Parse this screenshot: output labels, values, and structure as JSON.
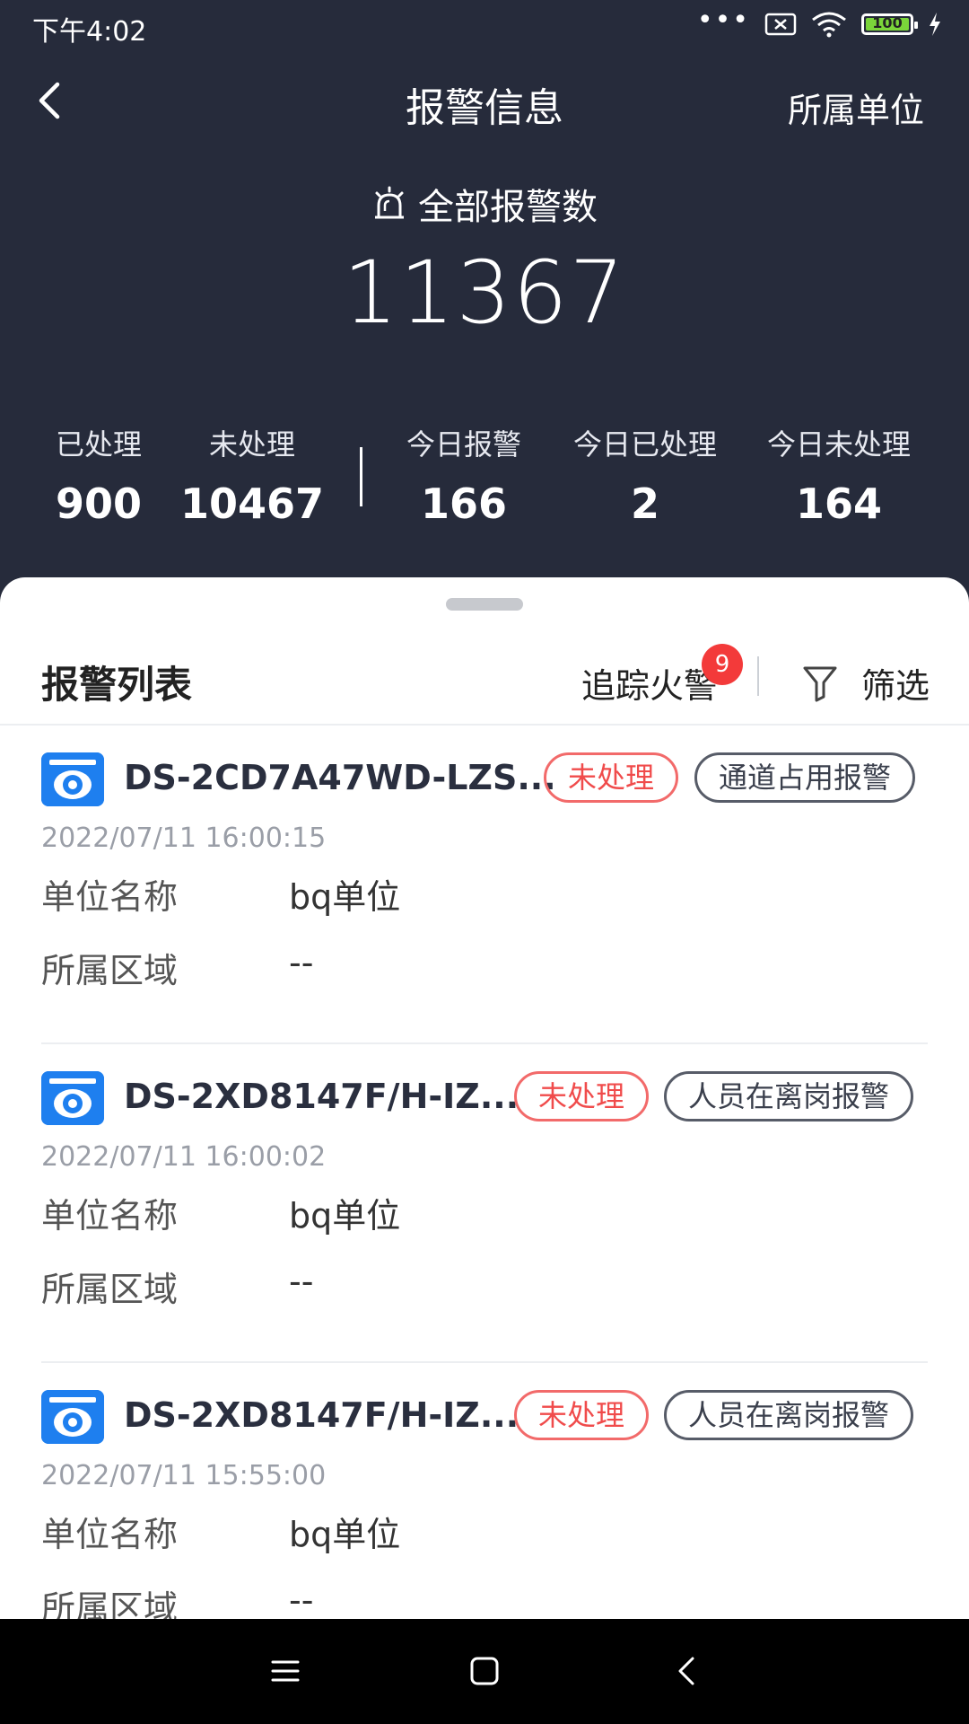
{
  "status_bar": {
    "time": "下午4:02",
    "battery": "100",
    "dots": "•••"
  },
  "header": {
    "title": "报警信息",
    "right_link": "所属单位"
  },
  "summary": {
    "label": "全部报警数",
    "total": "11367"
  },
  "stats": [
    {
      "label": "已处理",
      "value": "900"
    },
    {
      "label": "未处理",
      "value": "10467"
    },
    {
      "label": "今日报警",
      "value": "166"
    },
    {
      "label": "今日已处理",
      "value": "2"
    },
    {
      "label": "今日未处理",
      "value": "164"
    }
  ],
  "list": {
    "title": "报警列表",
    "track_label": "追踪火警",
    "track_badge": "9",
    "filter_label": "筛选",
    "items": [
      {
        "name": "DS-2CD7A47WD-LZS...",
        "status": "未处理",
        "type": "通道占用报警",
        "time": "2022/07/11 16:00:15",
        "unit_key": "单位名称",
        "unit_value": "bq单位",
        "area_key": "所属区域",
        "area_value": "--"
      },
      {
        "name": "DS-2XD8147F/H-IZ...",
        "status": "未处理",
        "type": "人员在离岗报警",
        "time": "2022/07/11 16:00:02",
        "unit_key": "单位名称",
        "unit_value": "bq单位",
        "area_key": "所属区域",
        "area_value": "--"
      },
      {
        "name": "DS-2XD8147F/H-IZ...",
        "status": "未处理",
        "type": "人员在离岗报警",
        "time": "2022/07/11 15:55:00",
        "unit_key": "单位名称",
        "unit_value": "bq单位",
        "area_key": "所属区域",
        "area_value": "--"
      }
    ]
  },
  "colors": {
    "header_bg": "#262b3b",
    "accent_blue": "#1e7fef",
    "status_red": "#f04b4b",
    "badge_red": "#f33a3a"
  }
}
